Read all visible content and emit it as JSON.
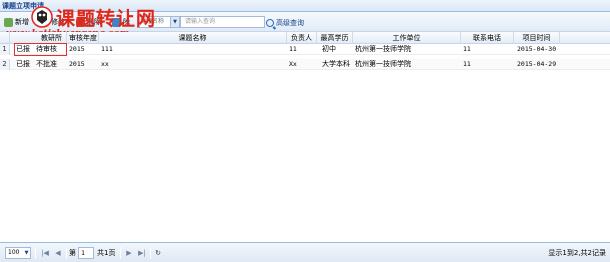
{
  "panel": {
    "title": "课题立项申请"
  },
  "watermark": {
    "main": "课题转让网",
    "url": "www.ketizhuanrang.com"
  },
  "toolbar": {
    "buttons": [
      {
        "label": "新增",
        "icon": "add-icon"
      },
      {
        "label": "修改",
        "icon": "edit-icon"
      },
      {
        "label": "删除",
        "icon": "delete-icon"
      },
      {
        "label": "除",
        "icon": "remove-icon"
      }
    ],
    "search_field": "课题名称",
    "search_placeholder": "请输入查询",
    "advanced_search": "高级查询"
  },
  "grid": {
    "columns": [
      "教研所",
      "审核年度",
      "课题名称",
      "负责人",
      "最高学历",
      "工作单位",
      "联系电话",
      "项目时间"
    ],
    "rows": [
      {
        "num": "1",
        "status": "已报",
        "review": "待审核",
        "year": "2015",
        "name": "111",
        "leader": "11",
        "degree": "初中",
        "unit": "杭州第一技师学院",
        "phone": "11",
        "date": "2015-04-30"
      },
      {
        "num": "2",
        "status": "已报",
        "review": "不批准",
        "year": "2015",
        "name": "xx",
        "leader": "Xx",
        "degree": "大学本科",
        "unit": "杭州第一技师学院",
        "phone": "11",
        "date": "2015-04-29"
      }
    ]
  },
  "pager": {
    "page_size": "100",
    "page_label_before": "第",
    "page_value": "1",
    "page_label_after": "共1页",
    "info": "显示1到2,共2记录"
  },
  "colors": {
    "accent": "#15428b",
    "border": "#99bbe8",
    "watermark": "#e1251b",
    "highlight": "#e03030"
  }
}
